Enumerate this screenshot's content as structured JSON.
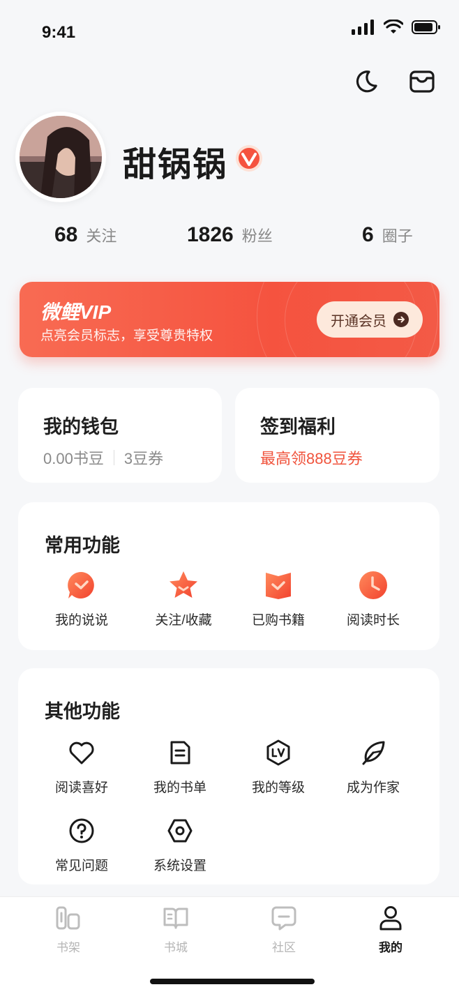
{
  "status_bar": {
    "time": "9:41"
  },
  "profile": {
    "username": "甜锅锅"
  },
  "stats": [
    {
      "num": "68",
      "label": "关注"
    },
    {
      "num": "1826",
      "label": "粉丝"
    },
    {
      "num": "6",
      "label": "圈子"
    }
  ],
  "vip": {
    "title": "微鲤VIP",
    "subtitle": "点亮会员标志，享受尊贵特权",
    "button": "开通会员"
  },
  "wallet": {
    "title": "我的钱包",
    "beans": "0.00书豆",
    "coupons": "3豆券"
  },
  "signin": {
    "title": "签到福利",
    "subtitle": "最高领888豆券"
  },
  "common": {
    "title": "常用功能",
    "items": [
      {
        "label": "我的说说",
        "icon": "comment-clock-icon"
      },
      {
        "label": "关注/收藏",
        "icon": "star-icon"
      },
      {
        "label": "已购书籍",
        "icon": "book-icon"
      },
      {
        "label": "阅读时长",
        "icon": "clock-icon"
      }
    ]
  },
  "other": {
    "title": "其他功能",
    "items": [
      {
        "label": "阅读喜好",
        "icon": "heart-icon"
      },
      {
        "label": "我的书单",
        "icon": "document-icon"
      },
      {
        "label": "我的等级",
        "icon": "level-icon"
      },
      {
        "label": "成为作家",
        "icon": "feather-icon"
      },
      {
        "label": "常见问题",
        "icon": "question-icon"
      },
      {
        "label": "系统设置",
        "icon": "settings-icon"
      }
    ]
  },
  "tabs": [
    {
      "label": "书架",
      "icon": "bookshelf-icon"
    },
    {
      "label": "书城",
      "icon": "open-book-icon"
    },
    {
      "label": "社区",
      "icon": "chat-icon"
    },
    {
      "label": "我的",
      "icon": "user-icon",
      "active": true
    }
  ],
  "colors": {
    "accent": "#f5533f",
    "background": "#f6f7f9",
    "card": "#ffffff"
  }
}
